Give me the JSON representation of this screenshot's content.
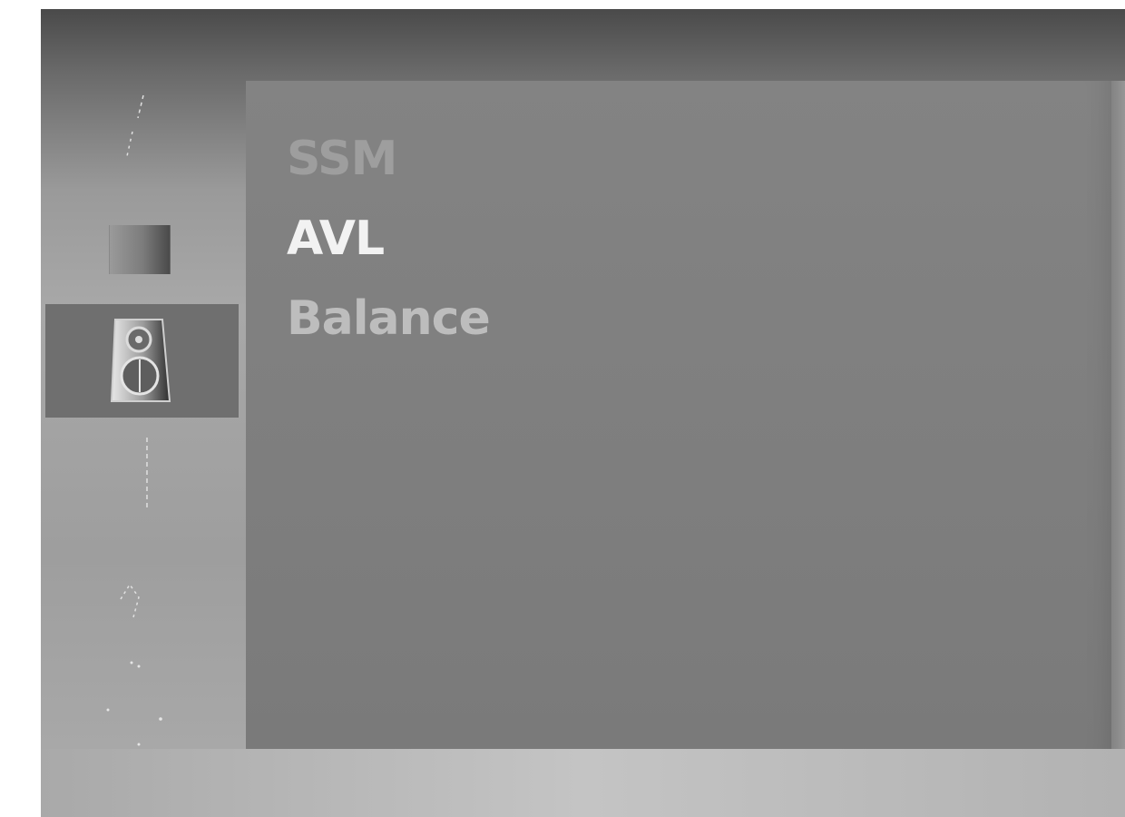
{
  "menu": {
    "items": [
      {
        "label": "SSM",
        "state": "dim"
      },
      {
        "label": "AVL",
        "state": "active"
      },
      {
        "label": "Balance",
        "state": "normal"
      }
    ]
  },
  "sidebar": {
    "icons": [
      "satellite-dish-icon",
      "picture-icon",
      "speaker-icon",
      "clock-icon",
      "antenna-icon",
      "lock-icon"
    ],
    "selected": "speaker-icon"
  },
  "colors": {
    "panel": "#808080",
    "selected_band": "#6f6f6f",
    "text_active": "#f2f2f2",
    "text_normal": "#bdbdbd",
    "text_dim": "#9e9e9e"
  }
}
